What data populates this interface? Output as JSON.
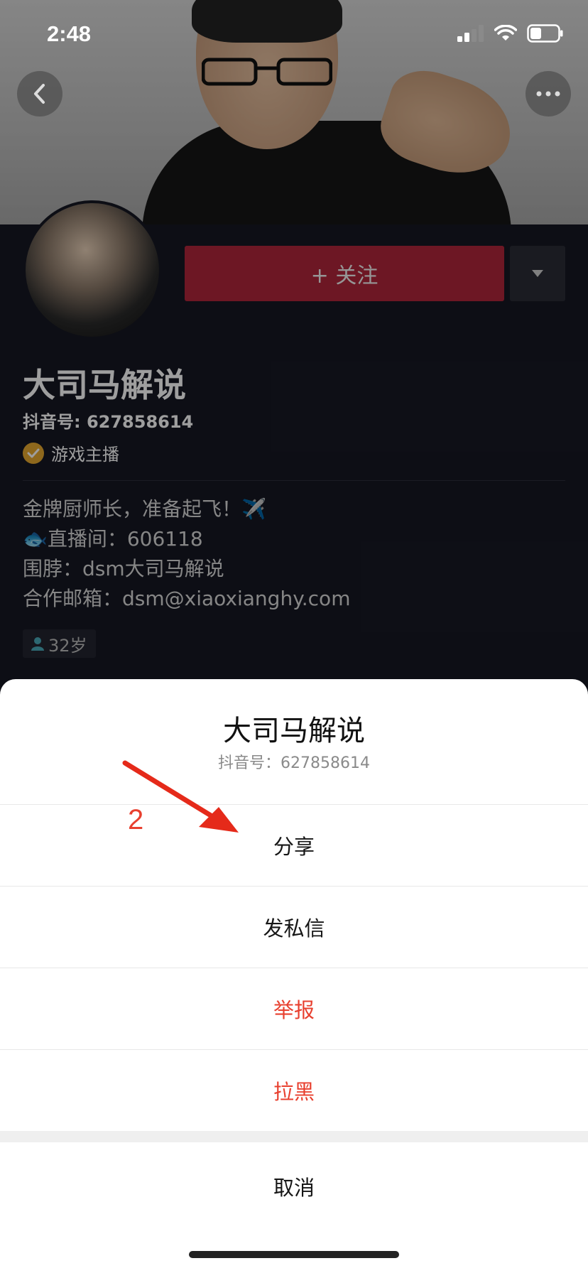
{
  "status_bar": {
    "time": "2:48"
  },
  "profile": {
    "follow_label": "+ 关注",
    "name": "大司马解说",
    "account_id": "抖音号: 627858614",
    "badge": "游戏主播",
    "bio_lines": [
      "金牌厨师长，准备起飞！✈️",
      "🐟直播间：606118",
      "围脖：dsm大司马解说",
      "合作邮箱：dsm@xiaoxianghy.com"
    ],
    "age": "32岁"
  },
  "action_sheet": {
    "title": "大司马解说",
    "subtitle": "抖音号：627858614",
    "items": [
      {
        "label": "分享",
        "danger": false
      },
      {
        "label": "发私信",
        "danger": false
      },
      {
        "label": "举报",
        "danger": true
      },
      {
        "label": "拉黑",
        "danger": true
      }
    ],
    "cancel_label": "取消"
  },
  "annotation": {
    "number": "2"
  },
  "colors": {
    "follow": "#b0263a",
    "danger": "#e8402f",
    "badge": "#e5a830",
    "background": "#161823"
  },
  "icons": [
    "back-icon",
    "more-icon",
    "signal-icon",
    "wifi-icon",
    "battery-icon",
    "caret-down-icon",
    "verified-icon",
    "person-icon"
  ]
}
